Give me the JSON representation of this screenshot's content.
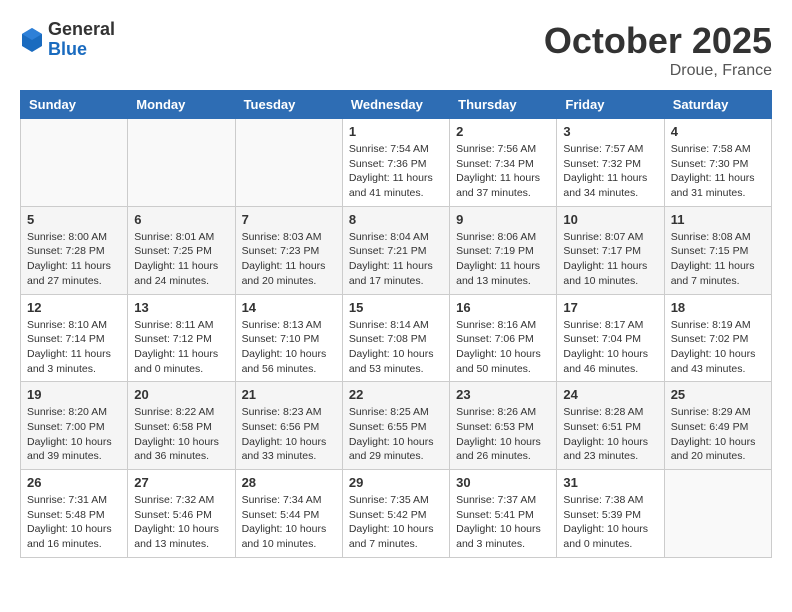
{
  "header": {
    "logo_general": "General",
    "logo_blue": "Blue",
    "month_title": "October 2025",
    "location": "Droue, France"
  },
  "weekdays": [
    "Sunday",
    "Monday",
    "Tuesday",
    "Wednesday",
    "Thursday",
    "Friday",
    "Saturday"
  ],
  "weeks": [
    [
      {
        "day": "",
        "info": ""
      },
      {
        "day": "",
        "info": ""
      },
      {
        "day": "",
        "info": ""
      },
      {
        "day": "1",
        "info": "Sunrise: 7:54 AM\nSunset: 7:36 PM\nDaylight: 11 hours\nand 41 minutes."
      },
      {
        "day": "2",
        "info": "Sunrise: 7:56 AM\nSunset: 7:34 PM\nDaylight: 11 hours\nand 37 minutes."
      },
      {
        "day": "3",
        "info": "Sunrise: 7:57 AM\nSunset: 7:32 PM\nDaylight: 11 hours\nand 34 minutes."
      },
      {
        "day": "4",
        "info": "Sunrise: 7:58 AM\nSunset: 7:30 PM\nDaylight: 11 hours\nand 31 minutes."
      }
    ],
    [
      {
        "day": "5",
        "info": "Sunrise: 8:00 AM\nSunset: 7:28 PM\nDaylight: 11 hours\nand 27 minutes."
      },
      {
        "day": "6",
        "info": "Sunrise: 8:01 AM\nSunset: 7:25 PM\nDaylight: 11 hours\nand 24 minutes."
      },
      {
        "day": "7",
        "info": "Sunrise: 8:03 AM\nSunset: 7:23 PM\nDaylight: 11 hours\nand 20 minutes."
      },
      {
        "day": "8",
        "info": "Sunrise: 8:04 AM\nSunset: 7:21 PM\nDaylight: 11 hours\nand 17 minutes."
      },
      {
        "day": "9",
        "info": "Sunrise: 8:06 AM\nSunset: 7:19 PM\nDaylight: 11 hours\nand 13 minutes."
      },
      {
        "day": "10",
        "info": "Sunrise: 8:07 AM\nSunset: 7:17 PM\nDaylight: 11 hours\nand 10 minutes."
      },
      {
        "day": "11",
        "info": "Sunrise: 8:08 AM\nSunset: 7:15 PM\nDaylight: 11 hours\nand 7 minutes."
      }
    ],
    [
      {
        "day": "12",
        "info": "Sunrise: 8:10 AM\nSunset: 7:14 PM\nDaylight: 11 hours\nand 3 minutes."
      },
      {
        "day": "13",
        "info": "Sunrise: 8:11 AM\nSunset: 7:12 PM\nDaylight: 11 hours\nand 0 minutes."
      },
      {
        "day": "14",
        "info": "Sunrise: 8:13 AM\nSunset: 7:10 PM\nDaylight: 10 hours\nand 56 minutes."
      },
      {
        "day": "15",
        "info": "Sunrise: 8:14 AM\nSunset: 7:08 PM\nDaylight: 10 hours\nand 53 minutes."
      },
      {
        "day": "16",
        "info": "Sunrise: 8:16 AM\nSunset: 7:06 PM\nDaylight: 10 hours\nand 50 minutes."
      },
      {
        "day": "17",
        "info": "Sunrise: 8:17 AM\nSunset: 7:04 PM\nDaylight: 10 hours\nand 46 minutes."
      },
      {
        "day": "18",
        "info": "Sunrise: 8:19 AM\nSunset: 7:02 PM\nDaylight: 10 hours\nand 43 minutes."
      }
    ],
    [
      {
        "day": "19",
        "info": "Sunrise: 8:20 AM\nSunset: 7:00 PM\nDaylight: 10 hours\nand 39 minutes."
      },
      {
        "day": "20",
        "info": "Sunrise: 8:22 AM\nSunset: 6:58 PM\nDaylight: 10 hours\nand 36 minutes."
      },
      {
        "day": "21",
        "info": "Sunrise: 8:23 AM\nSunset: 6:56 PM\nDaylight: 10 hours\nand 33 minutes."
      },
      {
        "day": "22",
        "info": "Sunrise: 8:25 AM\nSunset: 6:55 PM\nDaylight: 10 hours\nand 29 minutes."
      },
      {
        "day": "23",
        "info": "Sunrise: 8:26 AM\nSunset: 6:53 PM\nDaylight: 10 hours\nand 26 minutes."
      },
      {
        "day": "24",
        "info": "Sunrise: 8:28 AM\nSunset: 6:51 PM\nDaylight: 10 hours\nand 23 minutes."
      },
      {
        "day": "25",
        "info": "Sunrise: 8:29 AM\nSunset: 6:49 PM\nDaylight: 10 hours\nand 20 minutes."
      }
    ],
    [
      {
        "day": "26",
        "info": "Sunrise: 7:31 AM\nSunset: 5:48 PM\nDaylight: 10 hours\nand 16 minutes."
      },
      {
        "day": "27",
        "info": "Sunrise: 7:32 AM\nSunset: 5:46 PM\nDaylight: 10 hours\nand 13 minutes."
      },
      {
        "day": "28",
        "info": "Sunrise: 7:34 AM\nSunset: 5:44 PM\nDaylight: 10 hours\nand 10 minutes."
      },
      {
        "day": "29",
        "info": "Sunrise: 7:35 AM\nSunset: 5:42 PM\nDaylight: 10 hours\nand 7 minutes."
      },
      {
        "day": "30",
        "info": "Sunrise: 7:37 AM\nSunset: 5:41 PM\nDaylight: 10 hours\nand 3 minutes."
      },
      {
        "day": "31",
        "info": "Sunrise: 7:38 AM\nSunset: 5:39 PM\nDaylight: 10 hours\nand 0 minutes."
      },
      {
        "day": "",
        "info": ""
      }
    ]
  ]
}
